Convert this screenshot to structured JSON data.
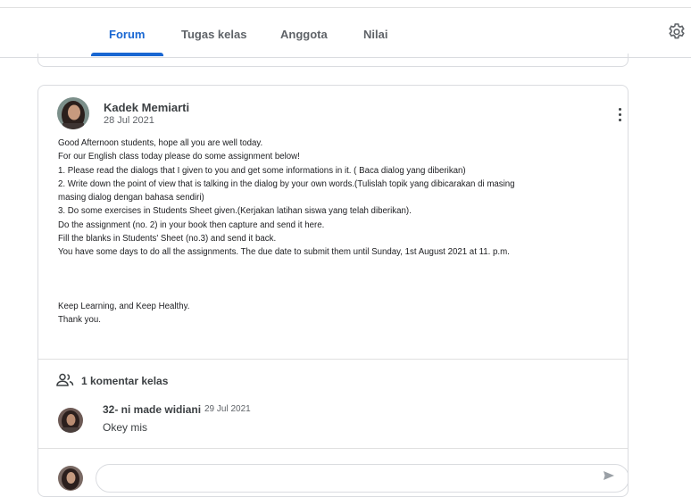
{
  "tabs": [
    {
      "label": "Forum"
    },
    {
      "label": "Tugas kelas"
    },
    {
      "label": "Anggota"
    },
    {
      "label": "Nilai"
    }
  ],
  "post": {
    "author": "Kadek Memiarti",
    "date": "28 Jul 2021",
    "body": [
      "Good Afternoon students, hope all you are well today.",
      "For our English class today please do some assignment below!",
      "1. Please read the dialogs that I given to you and get some informations in it. ( Baca dialog yang diberikan)",
      "2. Write down the point of view that is talking in the dialog by your own words.(Tulislah topik yang dibicarakan di masing",
      "masing dialog dengan bahasa sendiri)",
      "3. Do some exercises in Students Sheet given.(Kerjakan latihan siswa yang telah diberikan).",
      "Do  the assignment (no. 2) in your book then capture and send it here.",
      "Fill the blanks in Students' Sheet (no.3) and send it back.",
      "You have some days to do all the assignments. The due date to submit them until Sunday, 1st August 2021 at 11. p.m.",
      "",
      "",
      "Keep Learning, and Keep Healthy.",
      "Thank you."
    ]
  },
  "comments": {
    "summary": "1 komentar kelas",
    "items": [
      {
        "author": "32- ni made widiani",
        "date": "29 Jul 2021",
        "text": "Okey mis"
      }
    ]
  },
  "colors": {
    "accent": "#1967d2",
    "border": "#dadce0",
    "text": "#202124",
    "muted": "#5f6368"
  }
}
